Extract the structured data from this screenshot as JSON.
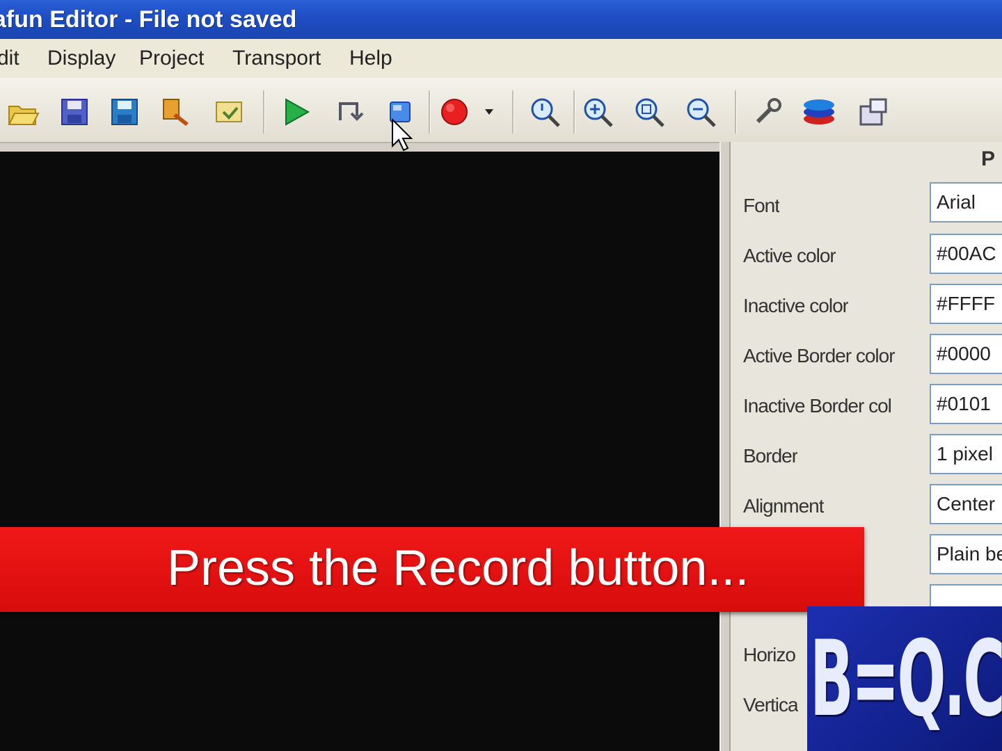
{
  "window": {
    "title": "afun Editor - File not saved"
  },
  "menu": {
    "items": [
      {
        "label": "dit"
      },
      {
        "label": "Display"
      },
      {
        "label": "Project"
      },
      {
        "label": "Transport"
      },
      {
        "label": "Help"
      }
    ]
  },
  "toolbar": {
    "icons": [
      "open-icon",
      "save-icon",
      "save-as-icon",
      "edit-icon",
      "import-icon",
      "play-icon",
      "loop-icon",
      "stop-icon",
      "record-icon",
      "dropdown-arrow-icon",
      "zoom-icon",
      "zoom-in-icon",
      "zoom-fit-icon",
      "zoom-out-icon",
      "tools-icon",
      "layers-icon",
      "settings-icon"
    ]
  },
  "properties": {
    "header": "P",
    "rows": [
      {
        "label": "Font",
        "value": "Arial"
      },
      {
        "label": "Active color",
        "value": "#00AC"
      },
      {
        "label": "Inactive color",
        "value": "#FFFF"
      },
      {
        "label": "Active Border color",
        "value": "#0000"
      },
      {
        "label": "Inactive Border col",
        "value": "#0101"
      },
      {
        "label": "Border",
        "value": "1 pixel"
      },
      {
        "label": "Alignment",
        "value": "Center"
      },
      {
        "label": "",
        "value": "Plain be"
      },
      {
        "label": "Horizo",
        "value": ""
      },
      {
        "label": "Vertica",
        "value": ""
      }
    ]
  },
  "caption": {
    "text": "Press the Record button..."
  },
  "watermark": {
    "text": "B=Q.CA"
  },
  "colors": {
    "caption_red": "#e81010",
    "canvas": "#0b0b0b",
    "titlebar": "#1f4fc4"
  }
}
